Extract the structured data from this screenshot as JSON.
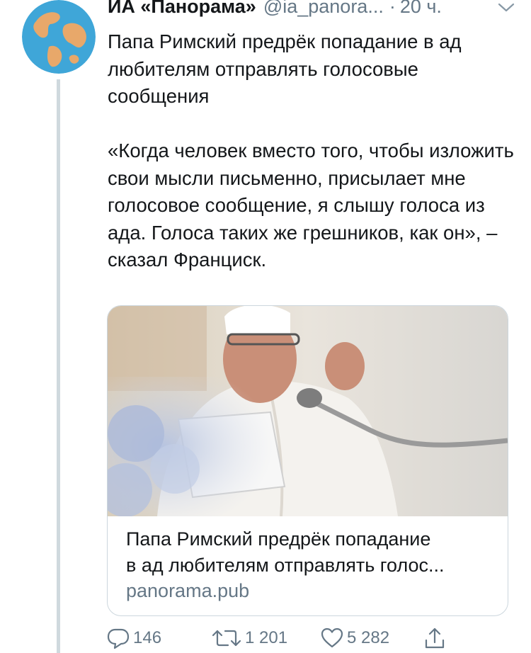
{
  "tweet": {
    "author_name": "ИА «Панорама»",
    "author_handle": "@ia_panora...",
    "separator": "·",
    "time": "20 ч.",
    "paragraphs": [
      "Папа Римский предрёк попадание в ад любителям отправлять голосовые сообщения",
      "«Когда человек вместо того, чтобы изложить свои мысли письменно, присылает мне голосовое сообщение, я слышу голоса из ада. Голоса таких же грешников, как он», – сказал Франциск."
    ]
  },
  "card": {
    "title_line1": "Папа Римский предрёк попадание",
    "title_line2": "в ад любителям отправлять голос...",
    "domain": "panorama.pub"
  },
  "actions": {
    "reply_count": "146",
    "retweet_count": "1 201",
    "like_count": "5 282"
  },
  "icons": {
    "avatar": "globe-icon",
    "menu": "chevron-down-icon",
    "reply": "reply-icon",
    "retweet": "retweet-icon",
    "like": "heart-icon",
    "share": "share-icon"
  },
  "colors": {
    "text": "#14171a",
    "secondary": "#657786",
    "border": "#ccd6dd",
    "globe_ocean": "#3fa6d8",
    "globe_land": "#e8a86a"
  }
}
